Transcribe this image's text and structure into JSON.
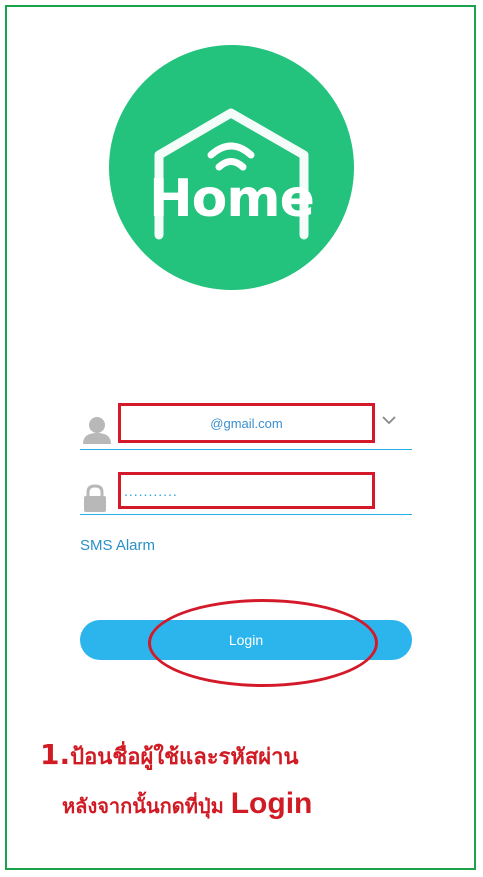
{
  "logo": {
    "text": "Home",
    "color": "#23c27d"
  },
  "login_form": {
    "email_value": "@gmail.com",
    "password_value": "...........",
    "sms_link_label": "SMS Alarm",
    "login_button_label": "Login"
  },
  "instructions": {
    "line1_number": "1.",
    "line1_text": "ป้อนชื่อผู้ใช้และรหัสผ่าน",
    "line2_text": "หลังจากนั้นกดที่ปุ่ม ",
    "line2_button_word": "Login"
  },
  "colors": {
    "frame": "#1aa34a",
    "accent": "#2bb5ec",
    "annotation": "#d41a2a"
  },
  "icons": [
    "user-icon",
    "lock-icon",
    "chevron-down-icon",
    "wifi-icon"
  ]
}
